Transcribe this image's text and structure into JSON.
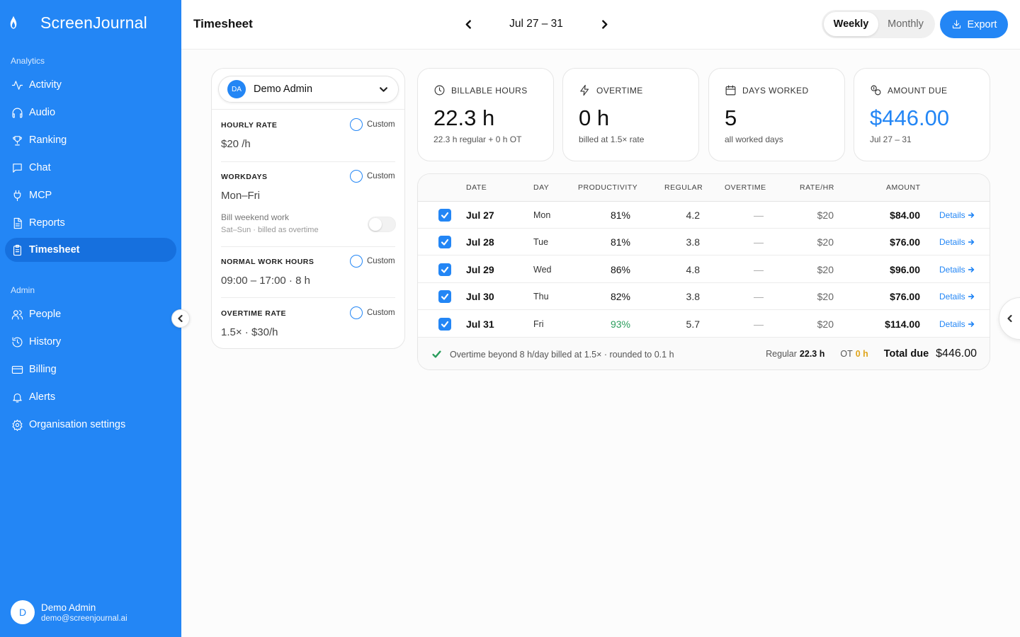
{
  "brand": {
    "name": "ScreenJournal",
    "logo_icon": "flame-icon"
  },
  "sidebar": {
    "analytics_label": "Analytics",
    "analytics_items": [
      {
        "label": "Activity",
        "icon": "activity-icon",
        "active": false
      },
      {
        "label": "Audio",
        "icon": "headphones-icon",
        "active": false
      },
      {
        "label": "Ranking",
        "icon": "trophy-icon",
        "active": false
      },
      {
        "label": "Chat",
        "icon": "chat-icon",
        "active": false
      },
      {
        "label": "MCP",
        "icon": "plug-icon",
        "active": false
      },
      {
        "label": "Reports",
        "icon": "file-icon",
        "active": false
      },
      {
        "label": "Timesheet",
        "icon": "clipboard-icon",
        "active": true
      }
    ],
    "admin_label": "Admin",
    "admin_items": [
      {
        "label": "People",
        "icon": "users-icon"
      },
      {
        "label": "History",
        "icon": "history-icon"
      },
      {
        "label": "Billing",
        "icon": "credit-card-icon"
      },
      {
        "label": "Alerts",
        "icon": "bell-icon"
      },
      {
        "label": "Organisation settings",
        "icon": "gear-icon"
      }
    ],
    "user": {
      "initial": "D",
      "name": "Demo Admin",
      "email": "demo@screenjournal.ai"
    }
  },
  "header": {
    "title": "Timesheet",
    "date_range": "Jul 27 – 31",
    "view_options": [
      "Weekly",
      "Monthly"
    ],
    "selected_view": "Weekly",
    "export_label": "Export"
  },
  "settings": {
    "user": {
      "initials": "DA",
      "name": "Demo Admin"
    },
    "custom_label": "Custom",
    "hourly_rate": {
      "label": "HOURLY RATE",
      "value": "$20 /h"
    },
    "workdays": {
      "label": "WORKDAYS",
      "value": "Mon–Fri"
    },
    "weekend": {
      "label": "Bill weekend work",
      "sub": "Sat–Sun · billed as overtime",
      "enabled": false
    },
    "normal_hours": {
      "label": "NORMAL WORK HOURS",
      "value": "09:00 – 17:00 · 8 h"
    },
    "overtime_rate": {
      "label": "OVERTIME RATE",
      "value": "1.5× · $30/h"
    }
  },
  "stats": [
    {
      "label": "BILLABLE HOURS",
      "icon": "clock-icon",
      "value": "22.3 h",
      "sub": "22.3 h regular + 0 h OT",
      "highlight": false
    },
    {
      "label": "OVERTIME",
      "icon": "bolt-icon",
      "value": "0 h",
      "sub": "billed at 1.5× rate",
      "highlight": false
    },
    {
      "label": "DAYS WORKED",
      "icon": "calendar-icon",
      "value": "5",
      "sub": "all worked days",
      "highlight": false
    },
    {
      "label": "AMOUNT DUE",
      "icon": "coins-icon",
      "value": "$446.00",
      "sub": "Jul 27 – 31",
      "highlight": true
    }
  ],
  "table": {
    "columns": [
      "DATE",
      "DAY",
      "PRODUCTIVITY",
      "REGULAR",
      "OVERTIME",
      "RATE/HR",
      "AMOUNT"
    ],
    "details_label": "Details",
    "rows": [
      {
        "date": "Jul 27",
        "day": "Mon",
        "productivity": "81%",
        "regular": "4.2",
        "overtime": "—",
        "rate": "$20",
        "amount": "$84.00",
        "checked": true,
        "prod_color": "#111111"
      },
      {
        "date": "Jul 28",
        "day": "Tue",
        "productivity": "81%",
        "regular": "3.8",
        "overtime": "—",
        "rate": "$20",
        "amount": "$76.00",
        "checked": true,
        "prod_color": "#111111"
      },
      {
        "date": "Jul 29",
        "day": "Wed",
        "productivity": "86%",
        "regular": "4.8",
        "overtime": "—",
        "rate": "$20",
        "amount": "$96.00",
        "checked": true,
        "prod_color": "#111111"
      },
      {
        "date": "Jul 30",
        "day": "Thu",
        "productivity": "82%",
        "regular": "3.8",
        "overtime": "—",
        "rate": "$20",
        "amount": "$76.00",
        "checked": true,
        "prod_color": "#111111"
      },
      {
        "date": "Jul 31",
        "day": "Fri",
        "productivity": "93%",
        "regular": "5.7",
        "overtime": "—",
        "rate": "$20",
        "amount": "$114.00",
        "checked": true,
        "prod_color": "#2a9d5c"
      }
    ],
    "footer": {
      "note": "Overtime beyond 8 h/day billed at 1.5× · rounded to 0.1 h",
      "regular_label": "Regular",
      "regular_value": "22.3 h",
      "ot_label": "OT",
      "ot_value": "0 h",
      "total_label": "Total due",
      "total_value": "$446.00"
    }
  },
  "colors": {
    "accent": "#2386f5",
    "success": "#2a9d5c",
    "warning": "#e0a51c"
  }
}
